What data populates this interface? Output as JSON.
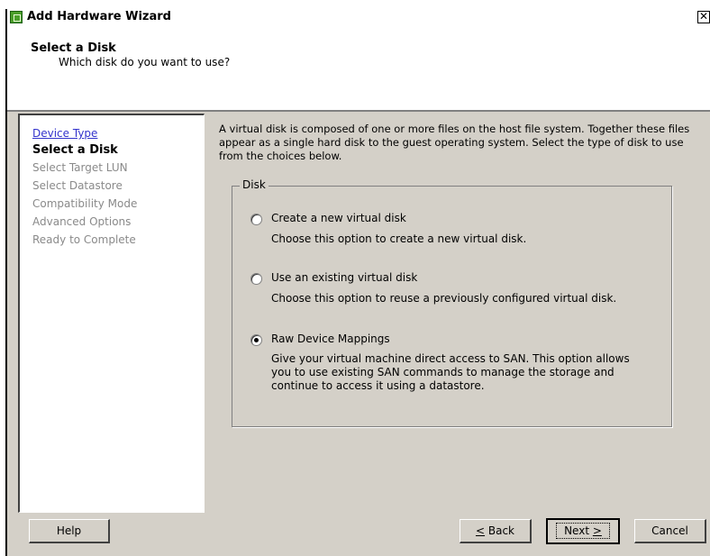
{
  "window": {
    "title": "Add Hardware Wizard",
    "close_glyph": "✕"
  },
  "header": {
    "title": "Select a Disk",
    "subtitle": "Which disk do you want to use?"
  },
  "steps": [
    {
      "label": "Device Type",
      "state": "link"
    },
    {
      "label": "Select a Disk",
      "state": "current"
    },
    {
      "label": "Select Target LUN",
      "state": "disabled"
    },
    {
      "label": "Select Datastore",
      "state": "disabled"
    },
    {
      "label": "Compatibility Mode",
      "state": "disabled"
    },
    {
      "label": "Advanced Options",
      "state": "disabled"
    },
    {
      "label": "Ready to Complete",
      "state": "disabled"
    }
  ],
  "content": {
    "description": "A virtual disk is composed of one or more files on the host file system. Together these files appear as a single hard disk to the guest operating system. Select the type of disk to use from the choices below.",
    "group_label": "Disk",
    "options": [
      {
        "label": "Create a new virtual disk",
        "description": "Choose this option to create a new virtual disk.",
        "selected": false
      },
      {
        "label": "Use an existing virtual disk",
        "description": "Choose this option to reuse a previously configured virtual disk.",
        "selected": false
      },
      {
        "label": "Raw Device Mappings",
        "description": "Give your virtual machine direct access to SAN. This option allows you to use existing SAN commands to manage the storage and continue to access it using a datastore.",
        "selected": true
      }
    ]
  },
  "buttons": {
    "help": "Help",
    "back_accel": "<",
    "back_rest": " Back",
    "next_rest": "Next ",
    "next_accel": ">",
    "cancel": "Cancel"
  }
}
